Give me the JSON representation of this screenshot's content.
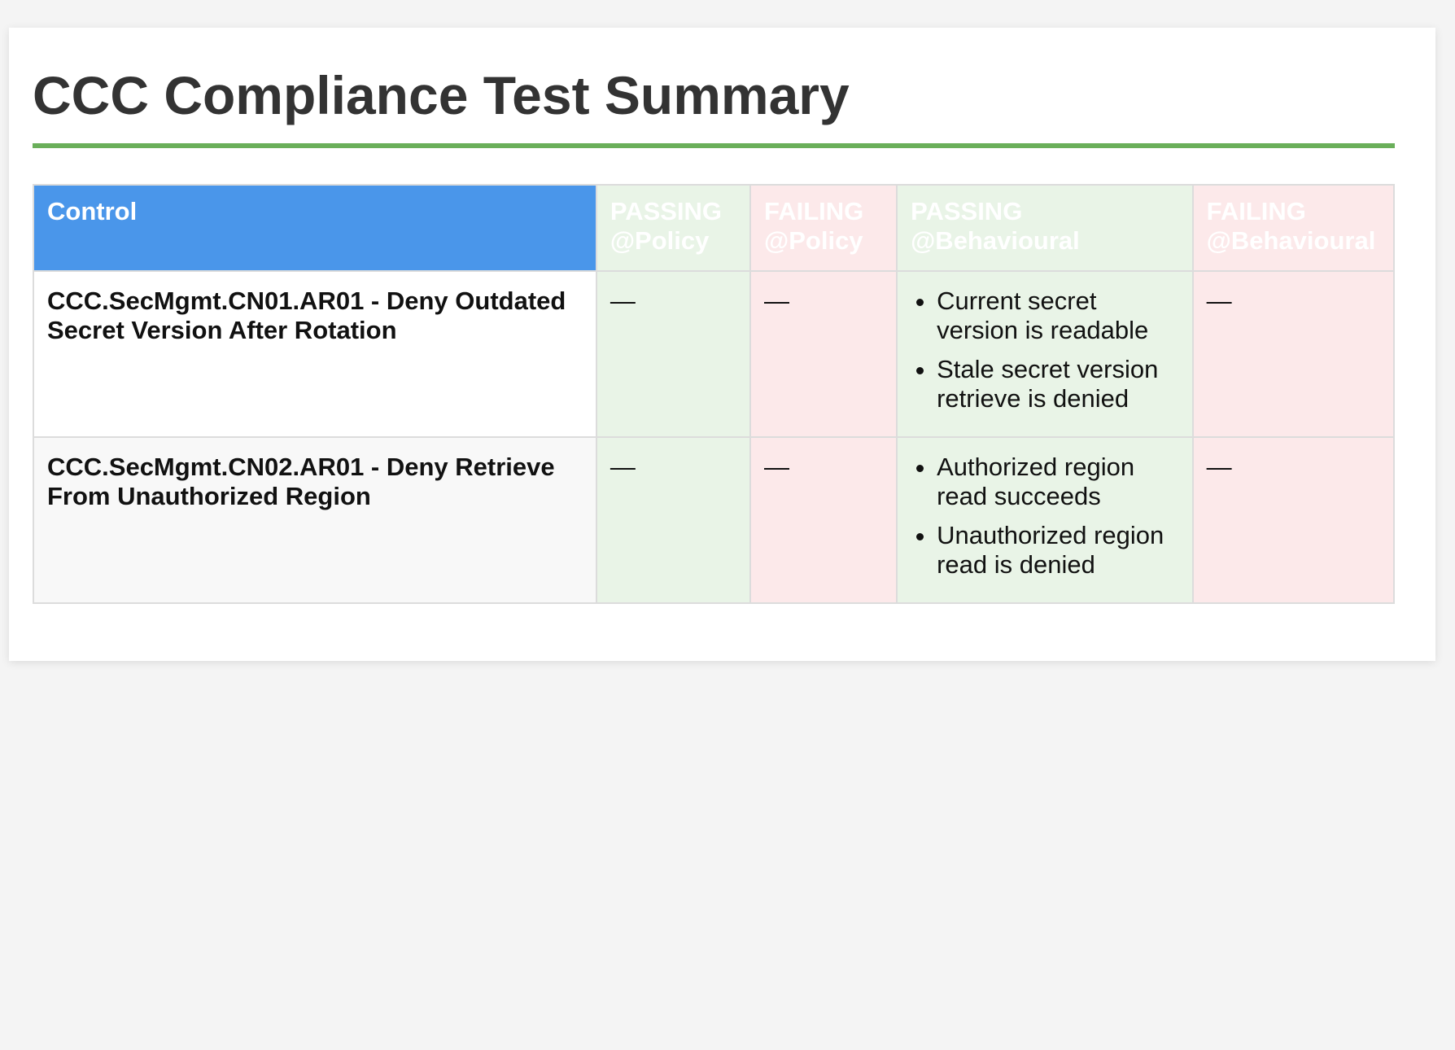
{
  "page": {
    "title": "CCC Compliance Test Summary"
  },
  "table": {
    "headers": {
      "control": "Control",
      "passing_policy": "PASSING @Policy",
      "failing_policy": "FAILING @Policy",
      "passing_behavioural": "PASSING @Behavioural",
      "failing_behavioural": "FAILING @Behavioural"
    },
    "rows": [
      {
        "control": "CCC.SecMgmt.CN01.AR01 - Deny Outdated Secret Version After Rotation",
        "passing_policy": "—",
        "failing_policy": "—",
        "passing_behavioural": [
          "Current secret version is readable",
          "Stale secret version retrieve is denied"
        ],
        "failing_behavioural": "—"
      },
      {
        "control": "CCC.SecMgmt.CN02.AR01 - Deny Retrieve From Unauthorized Region",
        "passing_policy": "—",
        "failing_policy": "—",
        "passing_behavioural": [
          "Authorized region read succeeds",
          "Unauthorized region read is denied"
        ],
        "failing_behavioural": "—"
      }
    ]
  },
  "colors": {
    "title_text": "#333333",
    "title_rule": "#6aaf5a",
    "control_header": "#4a96ea",
    "passing_bg": "#e9f4e7",
    "failing_bg": "#fce9ea",
    "border": "#dcdcdc"
  }
}
